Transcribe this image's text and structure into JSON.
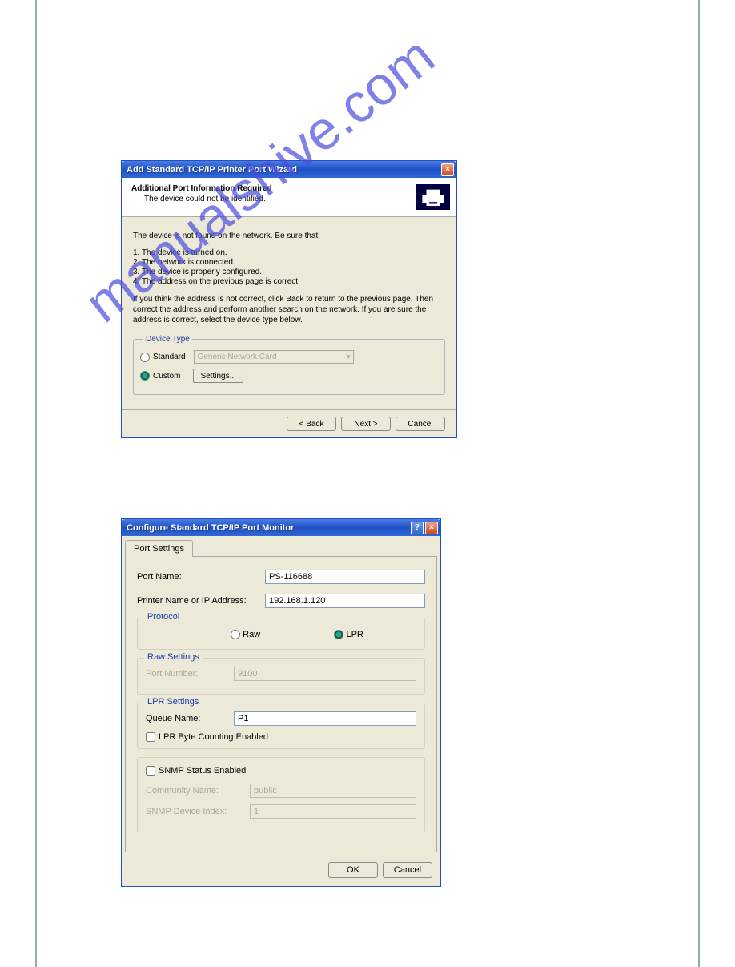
{
  "watermark": "manualshive.com",
  "dialog1": {
    "title": "Add Standard TCP/IP Printer Port Wizard",
    "header_title": "Additional Port Information Required",
    "header_sub": "The device could not be identified.",
    "info_line": "The device is not found on the network.  Be sure that:",
    "list": [
      "1.  The device is turned on.",
      "2.  The network is connected.",
      "3.  The device is properly configured.",
      "4.  The address on the previous page is correct."
    ],
    "para": "If you think the address is not correct, click Back to return to the previous page.  Then correct the address and perform another search on the network.  If you are sure the address is correct, select the device type below.",
    "device_type_legend": "Device Type",
    "standard_label": "Standard",
    "standard_combo": "Generic Network Card",
    "custom_label": "Custom",
    "settings_btn": "Settings...",
    "back_btn": "< Back",
    "next_btn": "Next >",
    "cancel_btn": "Cancel"
  },
  "dialog2": {
    "title": "Configure Standard TCP/IP Port Monitor",
    "tab_label": "Port Settings",
    "port_name_label": "Port Name:",
    "port_name_value": "PS-116688",
    "ip_label": "Printer Name or IP Address:",
    "ip_value": "192.168.1.120",
    "protocol_legend": "Protocol",
    "raw_label": "Raw",
    "lpr_label": "LPR",
    "raw_legend": "Raw Settings",
    "port_number_label": "Port Number:",
    "port_number_value": "9100",
    "lpr_legend": "LPR Settings",
    "queue_label": "Queue Name:",
    "queue_value": "P1",
    "lpr_byte_label": "LPR Byte Counting Enabled",
    "snmp_label": "SNMP Status Enabled",
    "community_label": "Community Name:",
    "community_value": "public",
    "snmp_index_label": "SNMP Device Index:",
    "snmp_index_value": "1",
    "ok_btn": "OK",
    "cancel_btn": "Cancel"
  }
}
